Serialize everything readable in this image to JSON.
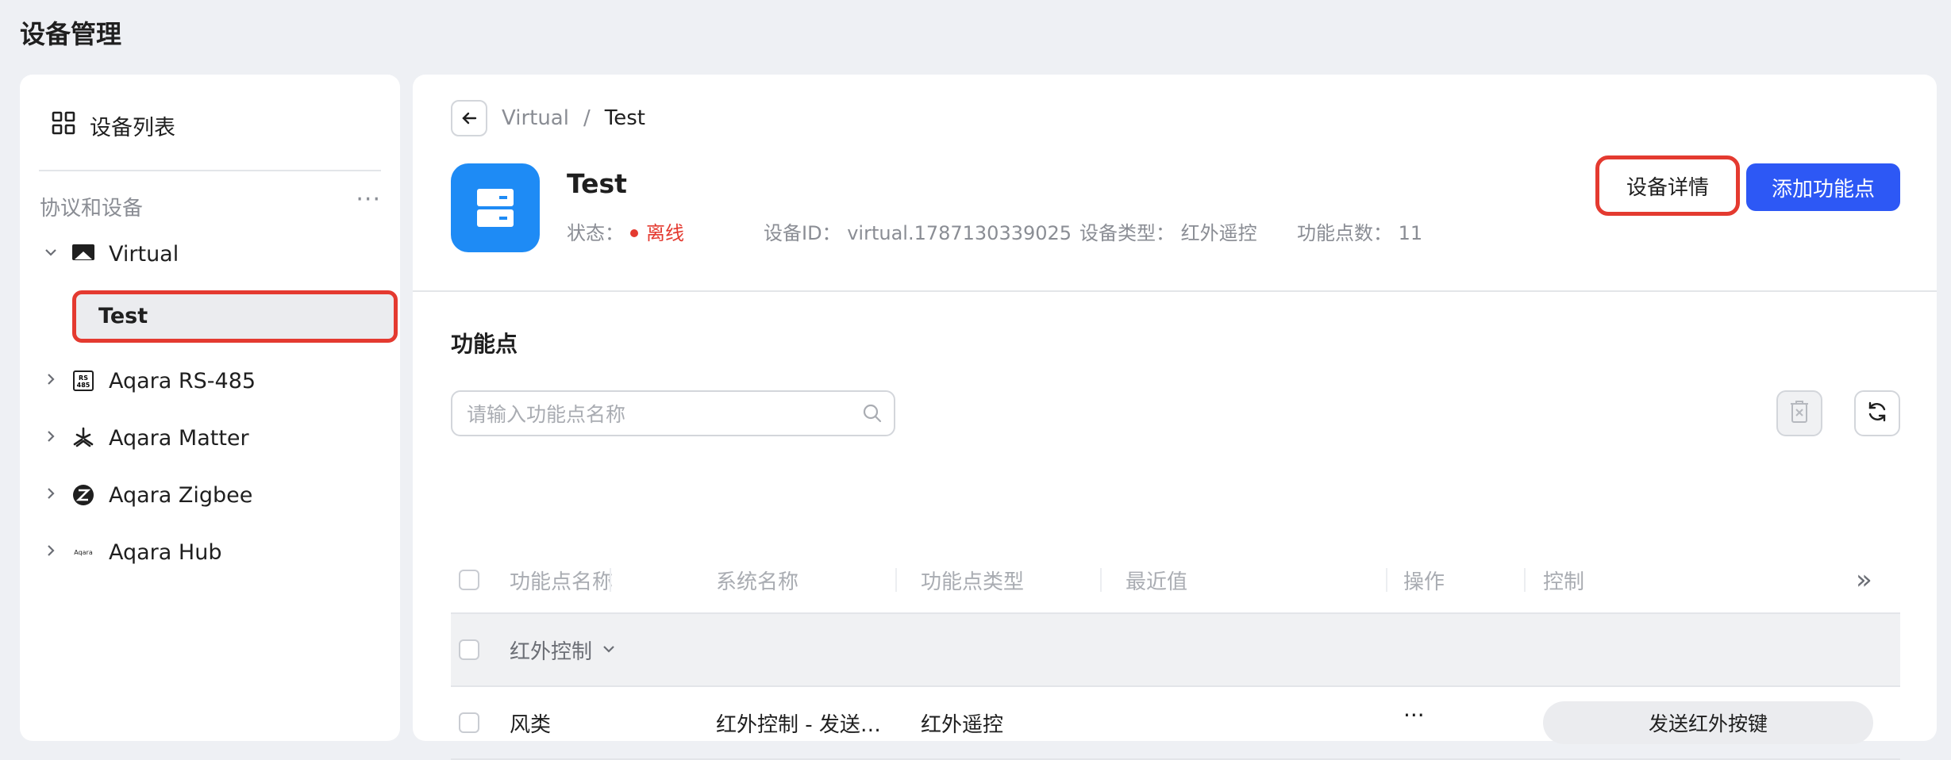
{
  "page": {
    "title": "设备管理"
  },
  "sidebar": {
    "header_label": "设备列表",
    "section_label": "协议和设备",
    "more": "···",
    "tree": [
      {
        "label": "Virtual",
        "expanded": true
      },
      {
        "label": "Test",
        "selected": true
      },
      {
        "label": "Aqara RS-485"
      },
      {
        "label": "Aqara Matter"
      },
      {
        "label": "Aqara Zigbee"
      },
      {
        "label": "Aqara Hub"
      }
    ],
    "rs485_badge_top": "RS",
    "rs485_badge_bottom": "485",
    "hub_logo": "Aqara"
  },
  "breadcrumb": {
    "parent": "Virtual",
    "sep": "/",
    "current": "Test"
  },
  "device": {
    "name": "Test",
    "status_label": "状态：",
    "status_value": "离线",
    "id_label": "设备ID：",
    "id_value": "virtual.1787130339025",
    "type_label": "设备类型：",
    "type_value": "红外遥控",
    "count_label": "功能点数：",
    "count_value": "11"
  },
  "actions": {
    "detail": "设备详情",
    "add": "添加功能点"
  },
  "features": {
    "title": "功能点",
    "search_placeholder": "请输入功能点名称",
    "columns": [
      "功能点名称",
      "系统名称",
      "功能点类型",
      "最近值",
      "操作",
      "控制"
    ],
    "expand_icon": "»",
    "group": {
      "label": "红外控制"
    },
    "rows": [
      {
        "name": "风类",
        "system": "红外控制 - 发送…",
        "type": "红外遥控",
        "latest": "",
        "op": "···",
        "control": "发送红外按键"
      }
    ]
  },
  "colors": {
    "accent": "#2d58f5",
    "offline": "#e43a30",
    "device_icon": "#1e8bf5",
    "highlight": "#e43a30"
  }
}
